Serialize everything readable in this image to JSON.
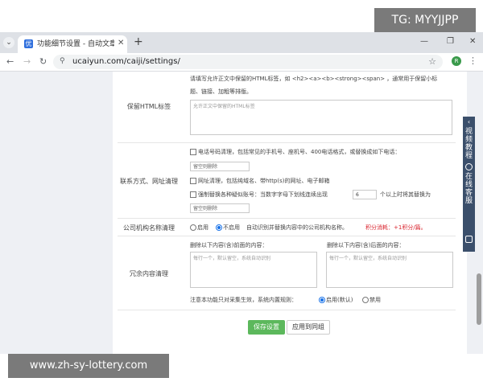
{
  "watermarks": {
    "top_right": "TG: MYYJJPP",
    "bottom_left": "www.zh-sy-lottery.com"
  },
  "browser": {
    "tab_title": "功能细节设置 - 自动文章采集",
    "url": "ucaiyun.com/caiji/settings/",
    "profile_letter": "R"
  },
  "settings": {
    "html_tags": {
      "label": "保留HTML标签",
      "desc_line1": "请填写允许正文中保留的HTML标签，如 <h2><a><b><strong><span> ，通常用于保留小标",
      "desc_line2": "题、链接、加粗等排版。",
      "placeholder": "允许正文中保留的HTML标签"
    },
    "contact": {
      "label": "联系方式、网址清理",
      "phone_option": "电话号码清理，包括常见的手机号、座机号、400电话格式，或替换成如下电话：",
      "phone_placeholder": "留空则删除",
      "url_option": "网址清理，包括纯域名、带http(s)的网址、电子邮箱",
      "account_option": "强制替换各种疑似账号：当数字字母下划线连续出现",
      "account_count": "6",
      "account_suffix": "个以上时将其替换为",
      "account_placeholder": "留空则删除"
    },
    "org_name": {
      "label": "公司机构名称清理",
      "enable": "启用",
      "disable": "不启用",
      "desc": "自动识别并替换内容中的公司机构名称。",
      "cost": "积分消耗：+1积分/篇。"
    },
    "redundant": {
      "label": "冗余内容清理",
      "before_title": "删除以下内容(含)前面的内容：",
      "after_title": "删除以下内容(含)后面的内容：",
      "before_placeholder": "每行一个，默认留空，系统自动识别",
      "after_placeholder": "每行一个，默认留空，系统自动识别"
    },
    "note": {
      "text": "注意本功能只对采集生效，系统内置规则：",
      "enable": "启用(默认)",
      "disable": "禁用"
    }
  },
  "buttons": {
    "save": "保存设置",
    "apply_group": "应用到同组"
  },
  "sidebar": {
    "video": "视频教程",
    "service": "在线客服"
  }
}
